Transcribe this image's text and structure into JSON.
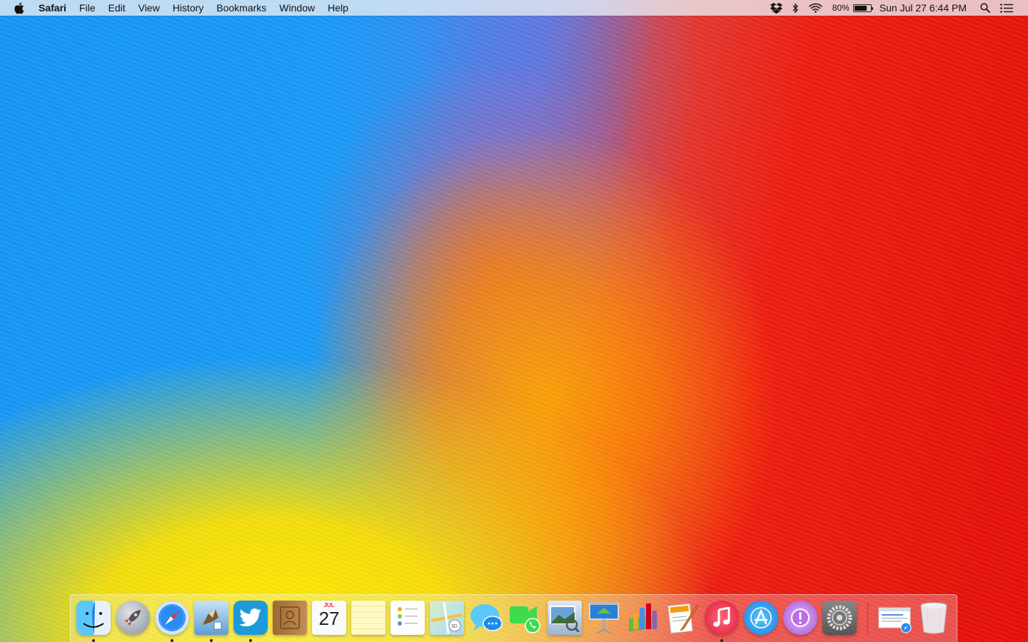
{
  "menubar": {
    "app_name": "Safari",
    "menus": [
      "File",
      "Edit",
      "View",
      "History",
      "Bookmarks",
      "Window",
      "Help"
    ],
    "battery_percent": "80%",
    "battery_level": 0.8,
    "clock": "Sun Jul 27  6:44 PM"
  },
  "dock": {
    "calendar_month": "JUL",
    "calendar_day": "27",
    "apps": [
      {
        "name": "Finder",
        "running": true
      },
      {
        "name": "Launchpad",
        "running": false
      },
      {
        "name": "Safari",
        "running": true
      },
      {
        "name": "Mail",
        "running": true
      },
      {
        "name": "Twitter",
        "running": true
      },
      {
        "name": "Contacts",
        "running": false
      },
      {
        "name": "Calendar",
        "running": false
      },
      {
        "name": "Notes",
        "running": false
      },
      {
        "name": "Reminders",
        "running": false
      },
      {
        "name": "Maps",
        "running": false
      },
      {
        "name": "Messages",
        "running": false
      },
      {
        "name": "FaceTime",
        "running": false
      },
      {
        "name": "Preview",
        "running": false
      },
      {
        "name": "Keynote",
        "running": false
      },
      {
        "name": "Numbers",
        "running": false
      },
      {
        "name": "Pages",
        "running": false
      },
      {
        "name": "iTunes",
        "running": true
      },
      {
        "name": "App Store",
        "running": false
      },
      {
        "name": "Feedback Assistant",
        "running": false
      },
      {
        "name": "System Preferences",
        "running": false
      },
      {
        "name": "Downloads Stack",
        "running": false
      },
      {
        "name": "Trash",
        "running": false
      }
    ]
  },
  "colors": {
    "wallpaper_blue": "#1596f5",
    "wallpaper_red": "#e41008",
    "wallpaper_yellow": "#ffe600"
  }
}
